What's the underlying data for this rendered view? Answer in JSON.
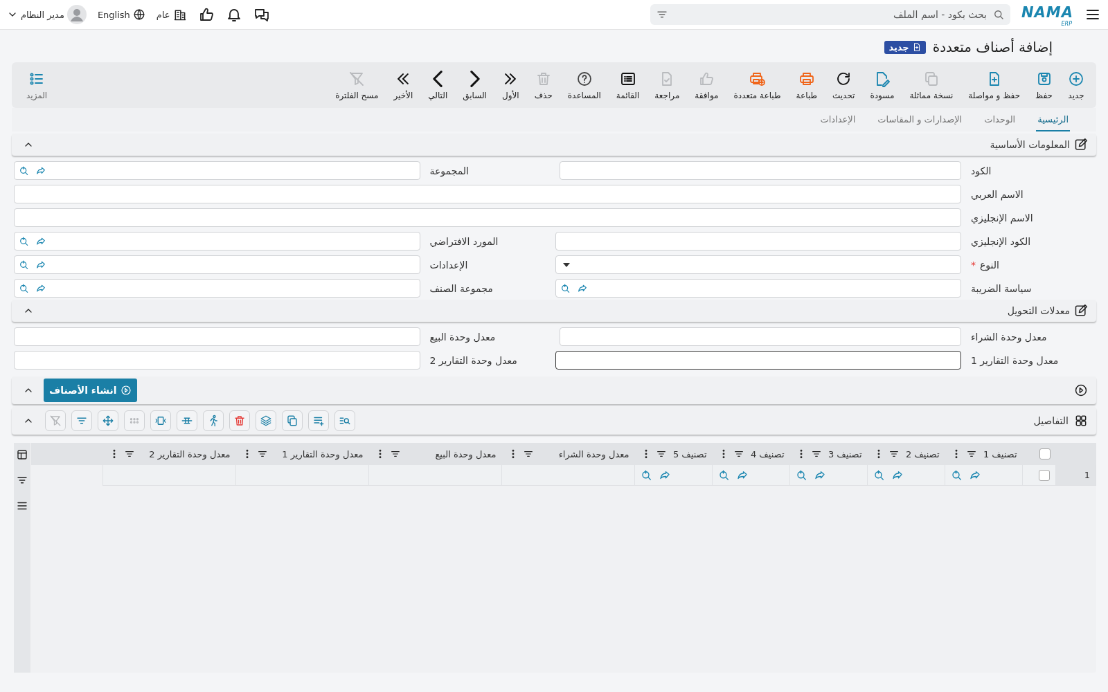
{
  "top_bar": {
    "logo": {
      "brand": "NAMA",
      "suffix": "ERP"
    },
    "search": {
      "placeholder": "بحث بكود - اسم الملف"
    },
    "company": "عام",
    "language": "English",
    "user": "مدير النظام"
  },
  "page": {
    "title": "إضافة أصناف متعددة",
    "badge": "جديد"
  },
  "toolbar": {
    "items": [
      {
        "label": "جديد",
        "disabled": false
      },
      {
        "label": "حفظ",
        "disabled": false
      },
      {
        "label": "حفظ و مواصلة",
        "disabled": false
      },
      {
        "label": "نسخة مماثلة",
        "disabled": true
      },
      {
        "label": "مسودة",
        "disabled": false
      },
      {
        "label": "تحديث",
        "disabled": false
      },
      {
        "label": "طباعة",
        "disabled": false
      },
      {
        "label": "طباعة متعددة",
        "disabled": false
      },
      {
        "label": "موافقة",
        "disabled": true
      },
      {
        "label": "مراجعة",
        "disabled": true
      },
      {
        "label": "القائمة",
        "disabled": false
      },
      {
        "label": "المساعدة",
        "disabled": false
      },
      {
        "label": "حذف",
        "disabled": true
      },
      {
        "label": "الأول",
        "disabled": false
      },
      {
        "label": "السابق",
        "disabled": false
      },
      {
        "label": "التالي",
        "disabled": false
      },
      {
        "label": "الأخير",
        "disabled": false
      },
      {
        "label": "مسح الفلترة",
        "disabled": true
      }
    ],
    "more": "المزيد"
  },
  "tabs": [
    {
      "label": "الرئيسية",
      "selected": true
    },
    {
      "label": "الوحدات",
      "selected": false
    },
    {
      "label": "الإصدارات و المقاسات",
      "selected": false
    },
    {
      "label": "الإعدادات",
      "selected": false
    }
  ],
  "basic_info": {
    "title": "المعلومات الأساسية",
    "expanded": true,
    "rows": [
      [
        {
          "label": "الكود",
          "kind": "text",
          "focused": false
        },
        {
          "label": "المجموعة",
          "kind": "lookup",
          "focused": false
        }
      ],
      [
        {
          "label": "الاسم العربي",
          "kind": "text",
          "focused": false
        }
      ],
      [
        {
          "label": "الاسم الإنجليزي",
          "kind": "text",
          "focused": false
        }
      ],
      [
        {
          "label": "الكود الإنجليزي",
          "kind": "text",
          "focused": false
        },
        {
          "label": "المورد الافتراضي",
          "kind": "lookup",
          "focused": false
        }
      ],
      [
        {
          "label": "النوع",
          "marker": "*",
          "kind": "select",
          "focused": false
        },
        {
          "label": "الإعدادات",
          "kind": "lookup",
          "focused": false
        }
      ],
      [
        {
          "label": "سياسة الضريبة",
          "kind": "lookup",
          "focused": false
        },
        {
          "label": "مجموعة الصنف",
          "kind": "lookup",
          "focused": false
        }
      ]
    ]
  },
  "conversion": {
    "title": "معدلات التحويل",
    "expanded": true,
    "rows": [
      [
        {
          "label": "معدل وحدة الشراء",
          "focused": false
        },
        {
          "label": "معدل وحدة البيع",
          "focused": false
        }
      ],
      [
        {
          "label": "معدل وحدة التقارير 1",
          "focused": true
        },
        {
          "label": "معدل وحدة التقارير 2",
          "focused": false
        }
      ]
    ]
  },
  "generate": {
    "action": "انشاء الأصناف",
    "expanded": true
  },
  "details": {
    "title": "التفاصيل",
    "expanded": true,
    "tools": [
      {
        "disabled": false
      },
      {
        "disabled": false
      },
      {
        "disabled": false
      },
      {
        "disabled": false
      },
      {
        "disabled": false
      },
      {
        "disabled": false
      },
      {
        "disabled": false
      },
      {
        "disabled": false
      },
      {
        "disabled": true
      },
      {
        "disabled": false
      },
      {
        "disabled": false
      },
      {
        "disabled": true
      }
    ],
    "grid": {
      "all_checked": false,
      "columns": [
        {
          "label": "تصنيف 1",
          "kind": "lookup"
        },
        {
          "label": "تصنيف 2",
          "kind": "lookup"
        },
        {
          "label": "تصنيف 3",
          "kind": "lookup"
        },
        {
          "label": "تصنيف 4",
          "kind": "lookup"
        },
        {
          "label": "تصنيف 5",
          "kind": "lookup"
        },
        {
          "label": "معدل وحدة الشراء",
          "kind": "number"
        },
        {
          "label": "معدل وحدة البيع",
          "kind": "number"
        },
        {
          "label": "معدل وحدة التقارير 1",
          "kind": "number"
        },
        {
          "label": "معدل وحدة التقارير 2",
          "kind": "number"
        }
      ],
      "rows": [
        {
          "number": "1",
          "checked": false
        }
      ]
    }
  }
}
